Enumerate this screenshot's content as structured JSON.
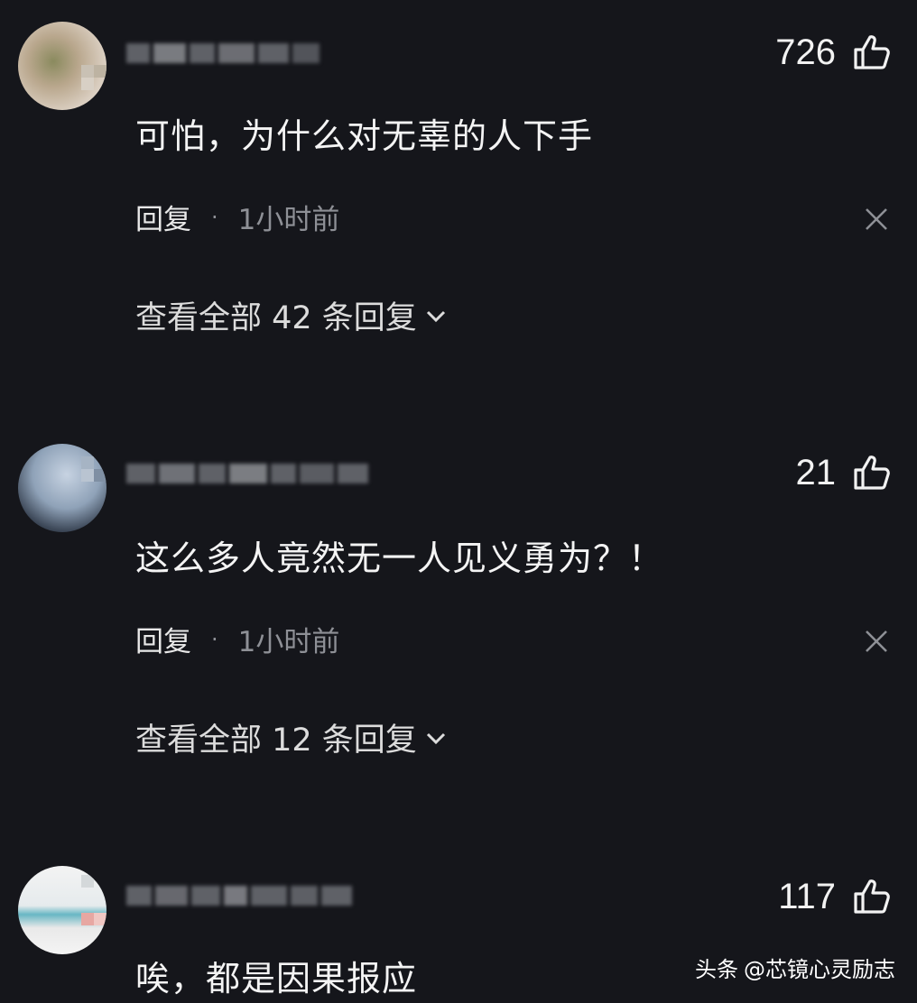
{
  "comments": [
    {
      "likes": "726",
      "text": "可怕，为什么对无辜的人下手",
      "reply_label": "回复",
      "separator": "·",
      "time": "1小时前",
      "view_replies": "查看全部 42 条回复"
    },
    {
      "likes": "21",
      "text": "这么多人竟然无一人见义勇为？！",
      "reply_label": "回复",
      "separator": "·",
      "time": "1小时前",
      "view_replies": "查看全部 12 条回复"
    },
    {
      "likes": "117",
      "text": "唉，都是因果报应"
    }
  ],
  "watermark": {
    "platform": "头条",
    "account": "@芯镜心灵励志"
  },
  "icons": {
    "like": "thumbs-up-icon",
    "close": "close-icon",
    "expand": "chevron-down-icon"
  },
  "colors": {
    "background": "#15161b",
    "text": "#f4f4f4",
    "muted": "#8e9096"
  }
}
